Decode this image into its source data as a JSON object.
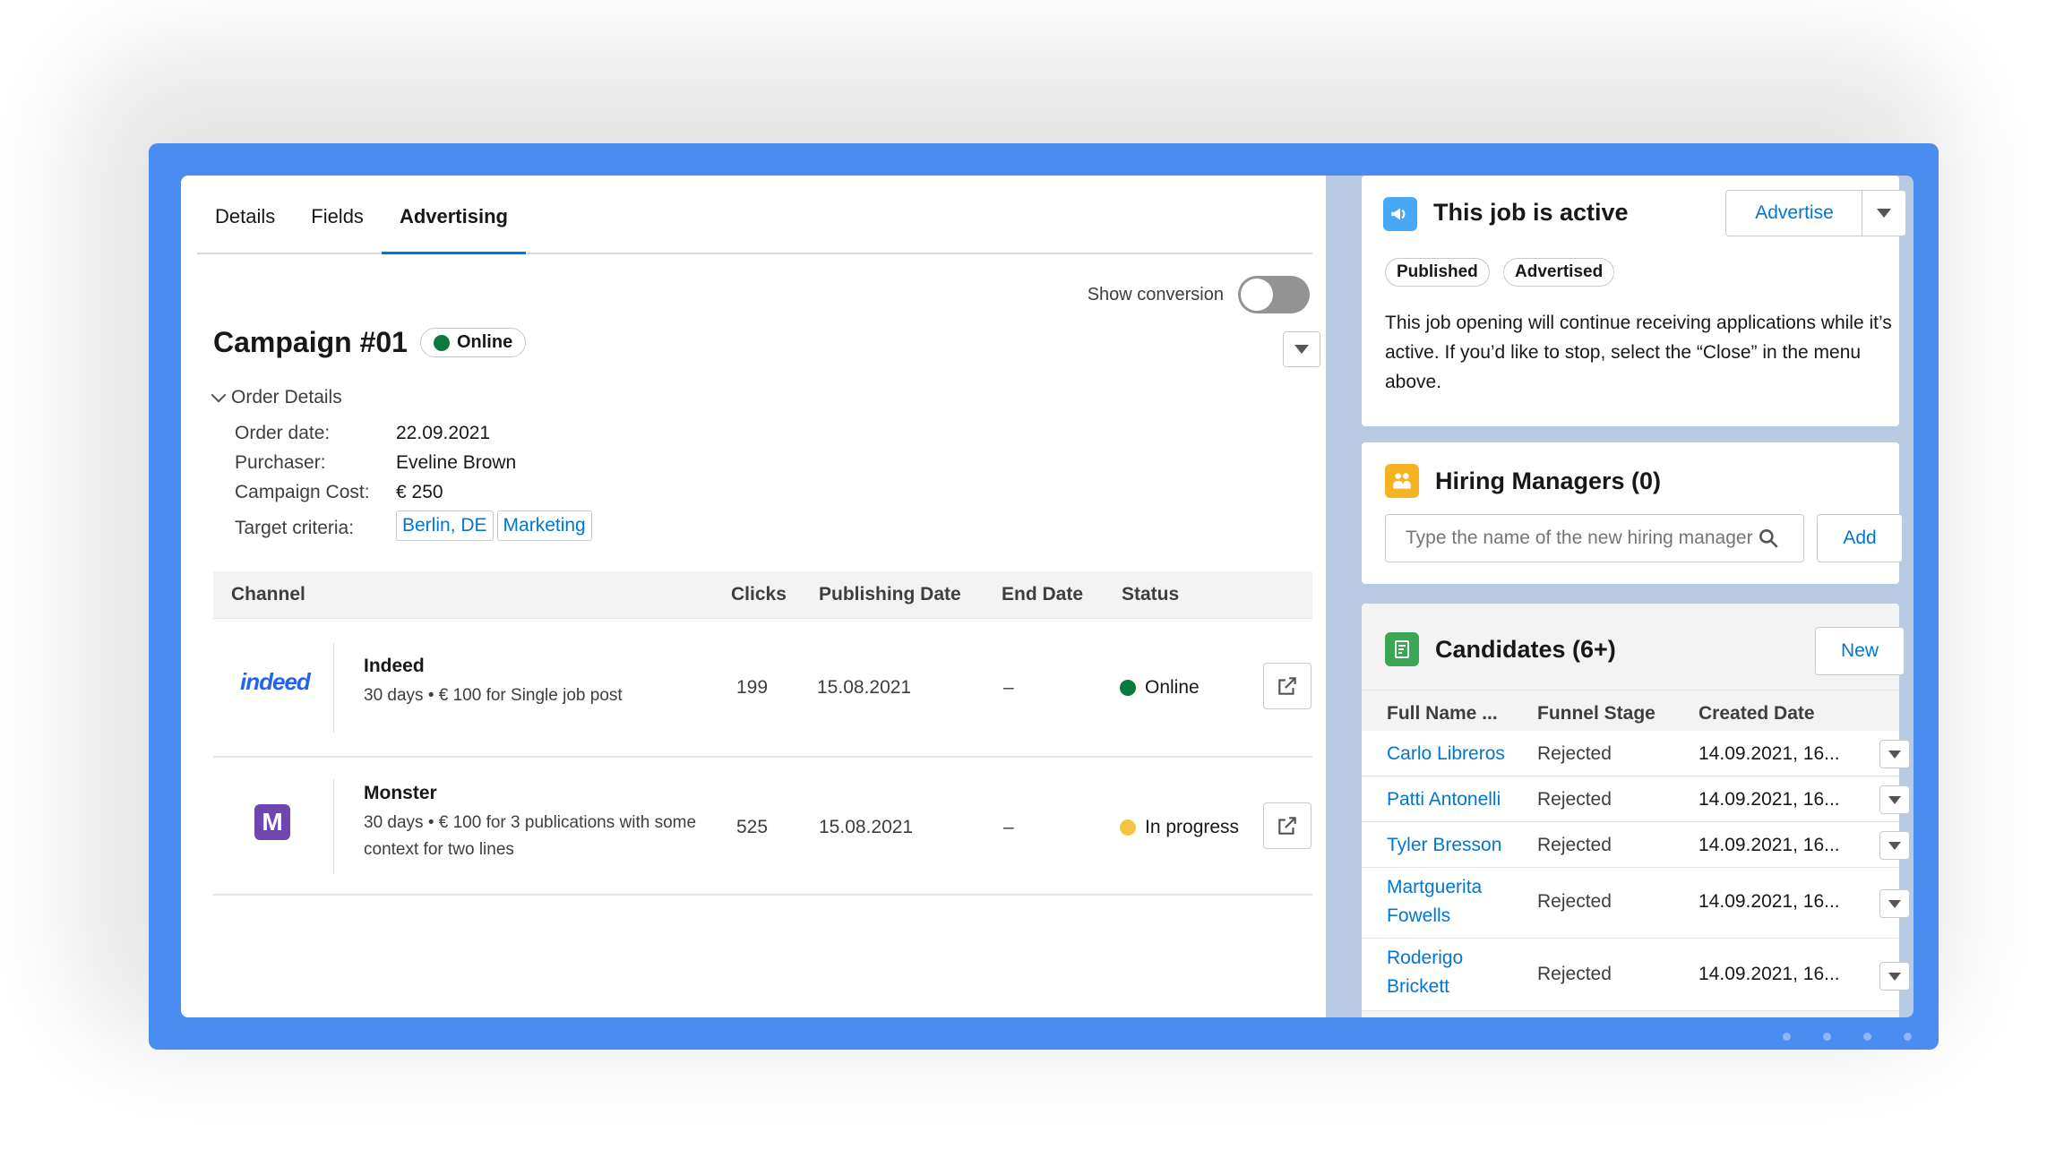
{
  "tabs": [
    "Details",
    "Fields",
    "Advertising"
  ],
  "show_conversion_label": "Show conversion",
  "campaign": {
    "title": "Campaign #01",
    "status": "Online",
    "order_details_label": "Order Details",
    "fields": [
      {
        "label": "Order date:",
        "value": "22.09.2021"
      },
      {
        "label": "Purchaser:",
        "value": "Eveline Brown"
      },
      {
        "label": "Campaign Cost:",
        "value": "€ 250"
      }
    ],
    "target_label": "Target criteria:",
    "target_criteria": [
      "Berlin, DE",
      "Marketing"
    ]
  },
  "channels_table": {
    "headers": [
      "Channel",
      "Clicks",
      "Publishing Date",
      "End Date",
      "Status"
    ],
    "rows": [
      {
        "logo": "indeed",
        "name": "Indeed",
        "desc": "30 days • € 100 for Single job post",
        "clicks": "199",
        "publishing_date": "15.08.2021",
        "end_date": "–",
        "status": "Online",
        "status_color": "#0b7a3e"
      },
      {
        "logo": "M",
        "name": "Monster",
        "desc": "30 days • € 100 for 3 publications with some context for two lines",
        "clicks": "525",
        "publishing_date": "15.08.2021",
        "end_date": "–",
        "status": "In progress",
        "status_color": "#f4c542"
      }
    ]
  },
  "job_card": {
    "title": "This job is active",
    "advertise_label": "Advertise",
    "badges": [
      "Published",
      "Advertised"
    ],
    "description": "This job opening will continue receiving applications while it’s active. If you’d like to stop, select the “Close” in the menu above."
  },
  "hiring_card": {
    "title": "Hiring Managers (0)",
    "search_placeholder": "Type the name of the new hiring manager",
    "add_label": "Add"
  },
  "candidates_card": {
    "title": "Candidates (6+)",
    "new_label": "New",
    "headers": [
      "Full Name ...",
      "Funnel Stage",
      "Created Date"
    ],
    "rows": [
      {
        "name": "Carlo Libreros",
        "stage": "Rejected",
        "date": "14.09.2021, 16..."
      },
      {
        "name": "Patti Antonelli",
        "stage": "Rejected",
        "date": "14.09.2021, 16..."
      },
      {
        "name": "Tyler Bresson",
        "stage": "Rejected",
        "date": "14.09.2021, 16..."
      },
      {
        "name": "Martguerita Fowells",
        "stage": "Rejected",
        "date": "14.09.2021, 16..."
      },
      {
        "name": "Roderigo Brickett",
        "stage": "Rejected",
        "date": "14.09.2021, 16..."
      }
    ]
  },
  "colors": {
    "accent": "#0176d3",
    "frame": "#4a8df0",
    "online": "#0b7a3e",
    "in_progress": "#f4c542"
  }
}
